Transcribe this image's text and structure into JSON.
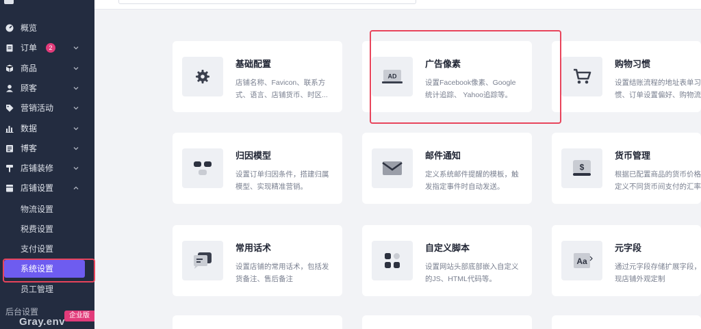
{
  "sidebar": {
    "items": [
      {
        "label": "概览",
        "icon": "dashboard-icon"
      },
      {
        "label": "订单",
        "icon": "order-icon",
        "badge": "2"
      },
      {
        "label": "商品",
        "icon": "product-icon"
      },
      {
        "label": "顾客",
        "icon": "customer-icon"
      },
      {
        "label": "营销活动",
        "icon": "tag-icon"
      },
      {
        "label": "数据",
        "icon": "chart-icon"
      },
      {
        "label": "博客",
        "icon": "blog-icon"
      },
      {
        "label": "店铺装修",
        "icon": "paint-icon"
      },
      {
        "label": "店铺设置",
        "icon": "store-icon"
      }
    ],
    "sub_items": [
      {
        "label": "物流设置"
      },
      {
        "label": "税费设置"
      },
      {
        "label": "支付设置"
      },
      {
        "label": "系统设置",
        "active": true
      },
      {
        "label": "员工管理"
      }
    ],
    "partial_item": "后台设置",
    "brand": "Gray.env",
    "edition_badge": "企业版"
  },
  "cards": [
    {
      "title": "基础配置",
      "desc_lines": [
        "店铺名称、Favicon、联系方",
        "式、语言、店铺货币、时区..."
      ],
      "icon": "gear-icon"
    },
    {
      "title": "广告像素",
      "desc_lines": [
        "设置Facebook像素、Google",
        "统计追踪、 Yahoo追踪等。"
      ],
      "icon": "ad-icon",
      "icon_text": "AD"
    },
    {
      "title": "购物习惯",
      "desc_lines": [
        "设置结账流程的地址表单习",
        "惯、订单设置偏好、购物流..."
      ],
      "icon": "cart-icon"
    },
    {
      "title": "归因模型",
      "desc_lines": [
        "设置订单归因条件，搭建归属",
        "模型、实现精准营销。"
      ],
      "icon": "attribution-icon"
    },
    {
      "title": "邮件通知",
      "desc_lines": [
        "定义系统邮件提醒的模板，触",
        "发指定事件时自动发送。"
      ],
      "icon": "mail-icon"
    },
    {
      "title": "货币管理",
      "desc_lines": [
        "根据已配置商品的货币价格，",
        "定义不同货币间支付的汇率..."
      ],
      "icon": "currency-icon",
      "icon_text": "$"
    },
    {
      "title": "常用话术",
      "desc_lines": [
        "设置店铺的常用话术，包括发",
        "货备注、售后备注"
      ],
      "icon": "chat-icon"
    },
    {
      "title": "自定义脚本",
      "desc_lines": [
        "设置网站头部底部嵌入自定义",
        "的JS、HTML代码等。"
      ],
      "icon": "script-icon"
    },
    {
      "title": "元字段",
      "desc_lines": [
        "通过元字段存储扩展字段，实",
        "现店铺外观定制"
      ],
      "icon": "metafield-icon",
      "icon_text": "Aa"
    }
  ],
  "colors": {
    "sidebar_bg": "#232c40",
    "active_item": "#6e5cf0",
    "badge": "#e23b7a",
    "highlight_box": "#e8445b",
    "page_bg": "#f2f3f6"
  }
}
